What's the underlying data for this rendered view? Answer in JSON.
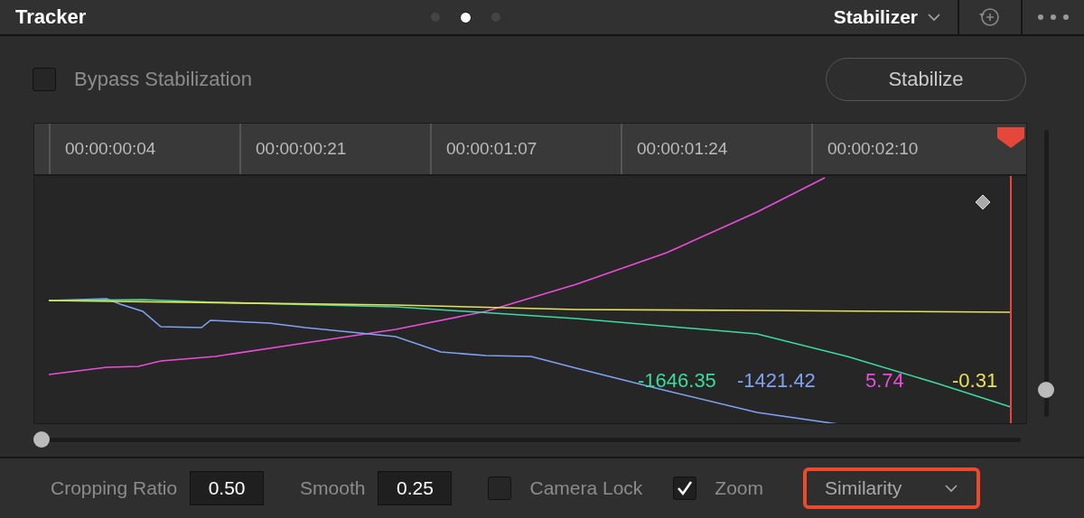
{
  "header": {
    "title": "Tracker",
    "page_dots": [
      {
        "selected": false
      },
      {
        "selected": true
      },
      {
        "selected": false
      }
    ],
    "mode_dropdown": "Stabilizer"
  },
  "bypass": {
    "label": "Bypass Stabilization",
    "checked": false
  },
  "stabilize_button": "Stabilize",
  "timeline": {
    "ruler_labels": [
      "00:00:00:04",
      "00:00:00:21",
      "00:00:01:07",
      "00:00:01:24",
      "00:00:02:10"
    ],
    "readings": [
      {
        "value": "-1646.35",
        "color": "#3ddba0"
      },
      {
        "value": "-1421.42",
        "color": "#7fa3f2"
      },
      {
        "value": "5.74",
        "color": "#ea4fd9"
      },
      {
        "value": "-0.31",
        "color": "#e6e25a"
      }
    ],
    "scroll_slider": {
      "level": 0
    },
    "zoom_slider": {
      "level": 0.07
    }
  },
  "bottom_bar": {
    "cropping_ratio": {
      "label": "Cropping Ratio",
      "value": "0.50"
    },
    "smooth": {
      "label": "Smooth",
      "value": "0.25"
    },
    "camera_lock": {
      "label": "Camera Lock",
      "checked": false
    },
    "zoom": {
      "label": "Zoom",
      "checked": true
    },
    "mode": {
      "value": "Similarity",
      "highlighted": true
    }
  }
}
